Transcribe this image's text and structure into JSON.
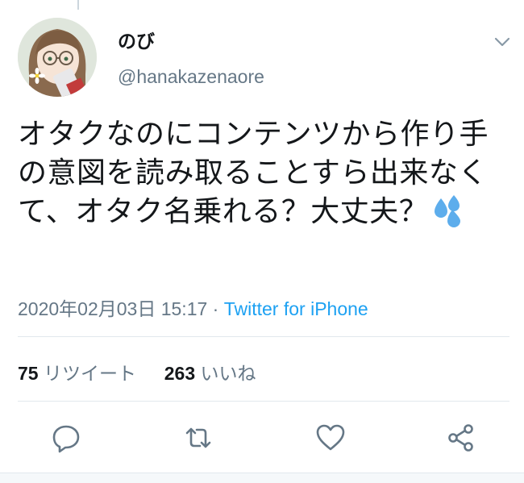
{
  "author": {
    "display_name": "のび",
    "handle": "@hanakazenaore"
  },
  "tweet": {
    "text": "オタクなのにコンテンツから作り手の意図を読み取ることすら出来なくて、オタク名乗れる？大丈夫？",
    "emoji": "sweat-droplets-icon"
  },
  "meta": {
    "timestamp": "2020年02月03日 15:17",
    "separator": "·",
    "source": "Twitter for iPhone"
  },
  "stats": {
    "retweets_count": "75",
    "retweets_label": "リツイート",
    "likes_count": "263",
    "likes_label": "いいね"
  },
  "actions": [
    "reply-icon",
    "retweet-icon",
    "like-icon",
    "share-icon"
  ],
  "colors": {
    "text": "#14171a",
    "secondary": "#657786",
    "link": "#1da1f2",
    "divider": "#e1e8ed",
    "emoji": "#5dadec"
  }
}
